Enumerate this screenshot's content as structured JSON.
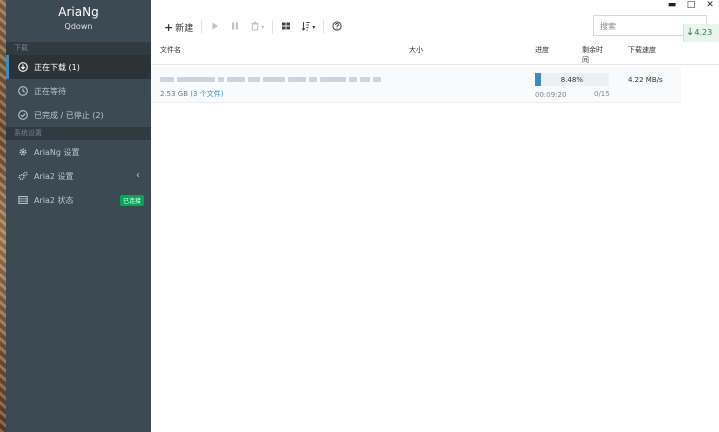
{
  "app": {
    "title": "AriaNg",
    "subtitle": "Qdown"
  },
  "sidebar": {
    "sections": [
      {
        "header": "下载",
        "items": [
          {
            "label": "正在下载 (1)",
            "icon": "download-circle-icon",
            "active": true
          },
          {
            "label": "正在等待",
            "icon": "clock-icon"
          },
          {
            "label": "已完成 / 已停止 (2)",
            "icon": "check-circle-icon"
          }
        ]
      },
      {
        "header": "系统设置",
        "items": [
          {
            "label": "AriaNg 设置",
            "icon": "gear-icon"
          },
          {
            "label": "Aria2 设置",
            "icon": "gears-icon"
          },
          {
            "label": "Aria2 状态",
            "icon": "server-icon",
            "badge": "已连接"
          }
        ]
      }
    ],
    "expand_indicator": "‹"
  },
  "toolbar": {
    "new_label": "新建",
    "sort_caret": "▾"
  },
  "search": {
    "placeholder": "搜索"
  },
  "floating_speed": {
    "value": "4.23"
  },
  "window_controls": [
    "▬",
    "□",
    "✕"
  ],
  "table": {
    "columns": {
      "name": "文件名",
      "size": "大小",
      "progress": "进度",
      "remaining": "剩余时\n间",
      "speed": "下载速度"
    },
    "rows": [
      {
        "size": "2.53 GB",
        "file_count": "(3 个文件)",
        "progress_percent": 8.48,
        "progress_text": "8.48%",
        "elapsed": "00:09:20",
        "connections": "0/15",
        "download_speed": "4.22 MB/s"
      }
    ]
  },
  "colors": {
    "sidebar_bg": "#3c4a54",
    "accent": "#3c8dbc",
    "badge_green": "#00a65a"
  }
}
